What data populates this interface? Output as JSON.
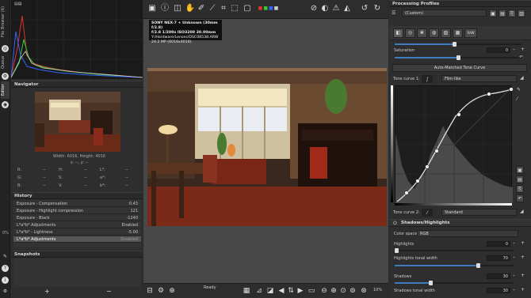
{
  "sidebar_tabs": [
    "File Browser (6)",
    "Queue",
    "Editor"
  ],
  "navigator": {
    "title": "Navigator",
    "size": "Width: 6016, Height: 4016",
    "cursor": "x: --, y: --",
    "readouts": [
      {
        "l1": "R:",
        "v1": "--",
        "l2": "H:",
        "v2": "--",
        "l3": "L*:",
        "v3": "--"
      },
      {
        "l1": "G:",
        "v1": "--",
        "l2": "S:",
        "v2": "--",
        "l3": "a*:",
        "v3": "--"
      },
      {
        "l1": "B:",
        "v1": "--",
        "l2": "V:",
        "v2": "--",
        "l3": "b*:",
        "v3": "--"
      }
    ]
  },
  "history": {
    "title": "History",
    "items": [
      {
        "label": "Exposure - Compensation",
        "value": "0.43"
      },
      {
        "label": "Exposure - Highlight compression",
        "value": "121"
      },
      {
        "label": "Exposure - Black",
        "value": "-1240"
      },
      {
        "label": "L*a*b* Adjustments",
        "value": "Enabled"
      },
      {
        "label": "L*a*b* - Lightness",
        "value": "-5.00"
      },
      {
        "label": "L*a*b* Adjustments",
        "value": "Disabled"
      }
    ],
    "zoom_pct": "0%"
  },
  "snapshots": {
    "title": "Snapshots",
    "add": "+",
    "remove": "−"
  },
  "photo_info": {
    "line1": "SONY NEX-7 + Unknown (30mm f/2.8)",
    "line2": "f/2.8  1/200s  ISO3200  30.00mm",
    "line3": "Y:/Hardware/Lenses/DSC08538.ARW",
    "line4": "24.2 MP (6016x4016)"
  },
  "status": {
    "text": "Ready",
    "zoom": "10%"
  },
  "right": {
    "processing_profiles": "Processing Profiles",
    "profile": "(Custom)",
    "saturation_label": "Saturation",
    "saturation_value": "0",
    "auto_curve": "Auto-Matched Tone Curve",
    "tone_curve1_label": "Tone curve 1:",
    "tone_curve1_mode": "Film-like",
    "tone_curve2_label": "Tone curve 2:",
    "tone_curve2_mode": "Standard",
    "sh_title": "Shadows/Highlights",
    "color_space_label": "Color space:",
    "color_space": "RGB",
    "highlights_label": "Highlights",
    "highlights_value": "0",
    "highlights_tw_label": "Highlights tonal width",
    "highlights_tw_value": "70",
    "shadows_label": "Shadows",
    "shadows_value": "30",
    "shadows_tw_label": "Shadows tonal width",
    "shadows_tw_value": "30",
    "tabs_extra": "RAW"
  },
  "colors": {
    "accent": "#3e7bbf",
    "panel": "#2e2e2e",
    "selected": "#555555"
  }
}
